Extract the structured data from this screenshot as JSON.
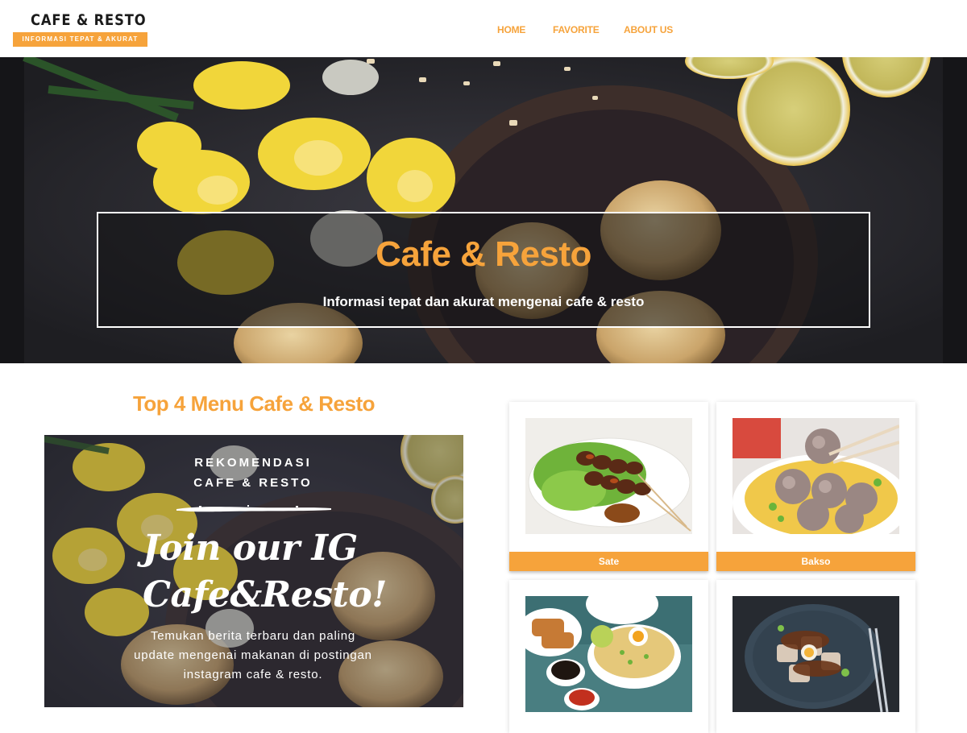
{
  "brand": {
    "title": "CAFE & RESTO",
    "tagline": "INFORMASI TEPAT & AKURAT",
    "accent_color": "#f6a33b"
  },
  "nav": {
    "items": [
      {
        "label": "HOME"
      },
      {
        "label": "FAVORITE"
      },
      {
        "label": "ABOUT US"
      }
    ]
  },
  "hero": {
    "title": "Cafe & Resto",
    "subtitle": "Informasi tepat dan akurat mengenai cafe & resto"
  },
  "section": {
    "title": "Top 4 Menu Cafe & Resto"
  },
  "promo": {
    "line1": "REKOMENDASI",
    "line2": "CAFE & RESTO",
    "headline1": "Join our IG",
    "headline2": "Cafe&Resto!",
    "description": "Temukan berita terbaru dan paling update mengenai makanan di postingan instagram cafe & resto."
  },
  "menu": {
    "items": [
      {
        "label": "Sate",
        "icon": "sate-photo"
      },
      {
        "label": "Bakso",
        "icon": "bakso-photo"
      },
      {
        "icon": "soto-photo"
      },
      {
        "icon": "siomay-photo"
      }
    ]
  }
}
